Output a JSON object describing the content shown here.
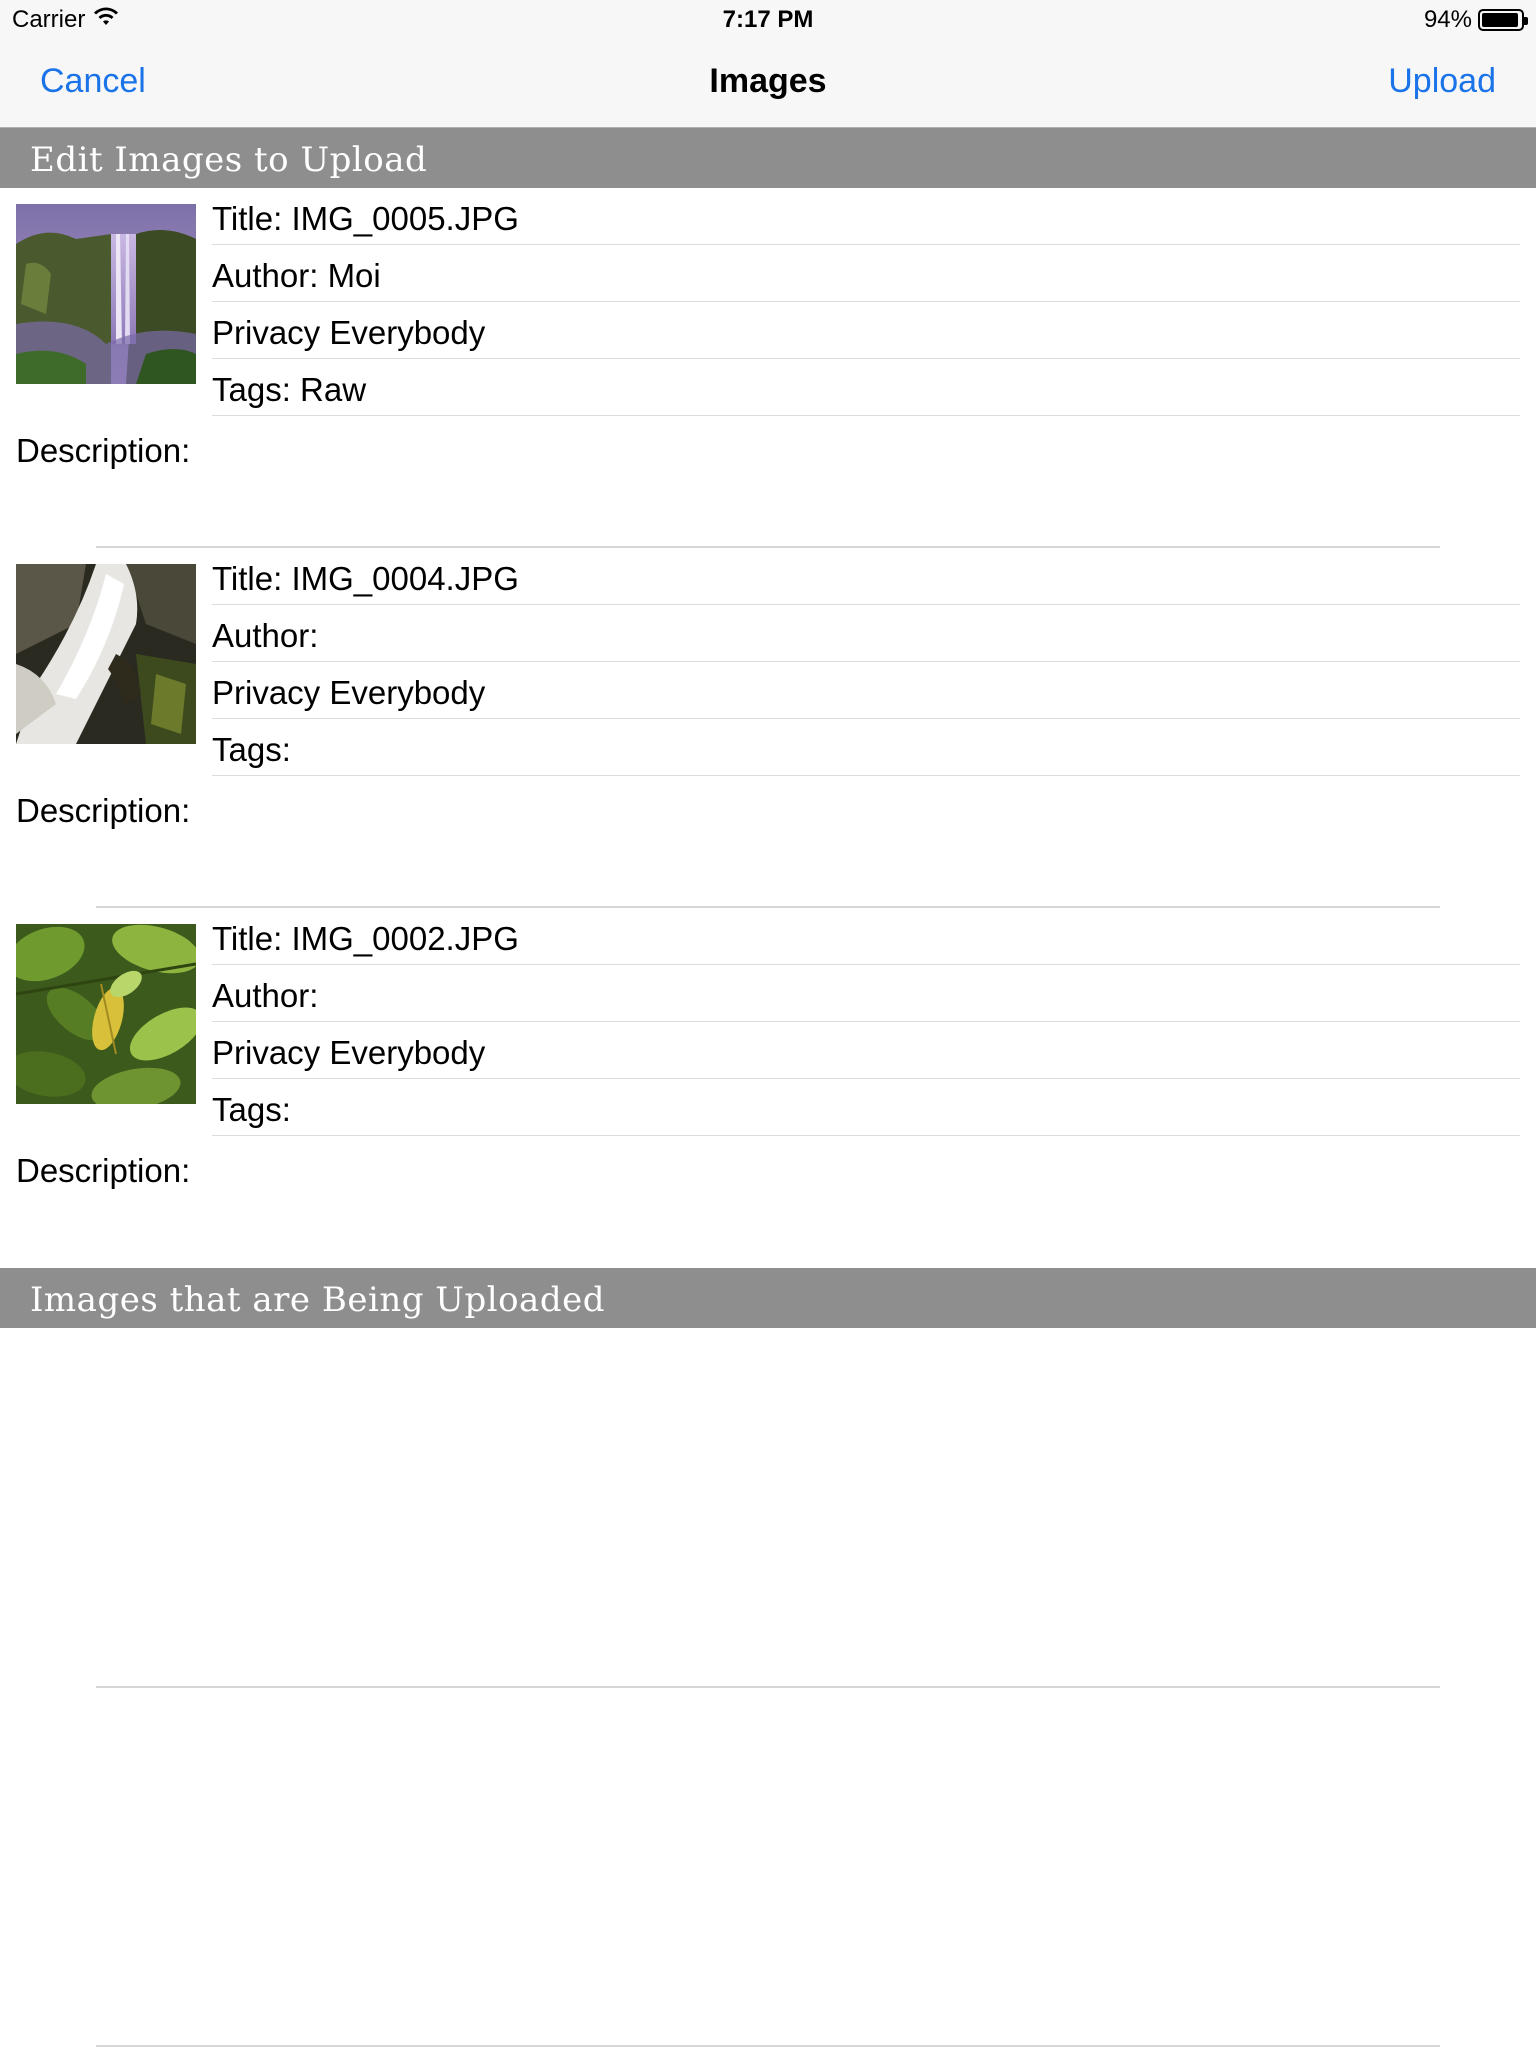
{
  "status_bar": {
    "carrier": "Carrier",
    "time": "7:17 PM",
    "battery": "94%",
    "battery_level": 0.94
  },
  "nav": {
    "cancel_label": "Cancel",
    "title": "Images",
    "upload_label": "Upload"
  },
  "sections": {
    "edit_header": "Edit Images to Upload",
    "uploading_header": "Images that are Being Uploaded"
  },
  "images": [
    {
      "title": "Title: IMG_0005.JPG",
      "author": "Author: Moi",
      "privacy": "Privacy Everybody",
      "tags": "Tags: Raw",
      "description": "Description:",
      "thumbnail": "waterfall-cliff-photo"
    },
    {
      "title": "Title: IMG_0004.JPG",
      "author": "Author:",
      "privacy": "Privacy Everybody",
      "tags": "Tags:",
      "description": "Description:",
      "thumbnail": "waterfall-rocks-photo"
    },
    {
      "title": "Title: IMG_0002.JPG",
      "author": "Author:",
      "privacy": "Privacy Everybody",
      "tags": "Tags:",
      "description": "Description:",
      "thumbnail": "green-leaves-photo"
    }
  ]
}
